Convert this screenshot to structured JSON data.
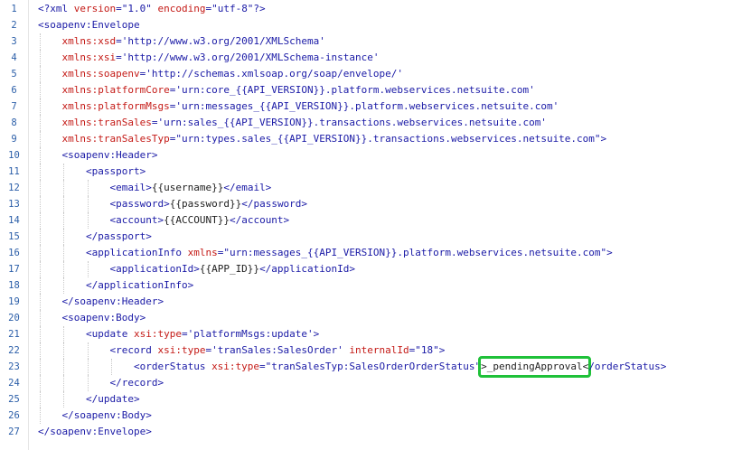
{
  "lines": [
    [
      {
        "t": "<?xml ",
        "c": "t-pi"
      },
      {
        "t": "version",
        "c": "t-attr"
      },
      {
        "t": "=\"1.0\" ",
        "c": "t-val"
      },
      {
        "t": "encoding",
        "c": "t-attr"
      },
      {
        "t": "=\"utf-8\"?>",
        "c": "t-val"
      }
    ],
    [
      {
        "t": "<soapenv:Envelope",
        "c": "t-tag"
      }
    ],
    [
      {
        "t": "    "
      },
      {
        "t": "xmlns:xsd",
        "c": "t-attr"
      },
      {
        "t": "='http://www.w3.org/2001/XMLSchema'",
        "c": "t-val"
      }
    ],
    [
      {
        "t": "    "
      },
      {
        "t": "xmlns:xsi",
        "c": "t-attr"
      },
      {
        "t": "='http://www.w3.org/2001/XMLSchema-instance'",
        "c": "t-val"
      }
    ],
    [
      {
        "t": "    "
      },
      {
        "t": "xmlns:soapenv",
        "c": "t-attr"
      },
      {
        "t": "='http://schemas.xmlsoap.org/soap/envelope/'",
        "c": "t-val"
      }
    ],
    [
      {
        "t": "    "
      },
      {
        "t": "xmlns:platformCore",
        "c": "t-attr"
      },
      {
        "t": "='urn:core_{{API_VERSION}}.platform.webservices.netsuite.com'",
        "c": "t-val"
      }
    ],
    [
      {
        "t": "    "
      },
      {
        "t": "xmlns:platformMsgs",
        "c": "t-attr"
      },
      {
        "t": "='urn:messages_{{API_VERSION}}.platform.webservices.netsuite.com'",
        "c": "t-val"
      }
    ],
    [
      {
        "t": "    "
      },
      {
        "t": "xmlns:tranSales",
        "c": "t-attr"
      },
      {
        "t": "='urn:sales_{{API_VERSION}}.transactions.webservices.netsuite.com'",
        "c": "t-val"
      }
    ],
    [
      {
        "t": "    "
      },
      {
        "t": "xmlns:tranSalesTyp",
        "c": "t-attr"
      },
      {
        "t": "=\"urn:types.sales_{{API_VERSION}}.transactions.webservices.netsuite.com\">",
        "c": "t-val"
      }
    ],
    [
      {
        "t": "    "
      },
      {
        "t": "<soapenv:Header>",
        "c": "t-tag"
      }
    ],
    [
      {
        "t": "        "
      },
      {
        "t": "<passport>",
        "c": "t-tag"
      }
    ],
    [
      {
        "t": "            "
      },
      {
        "t": "<email>",
        "c": "t-tag"
      },
      {
        "t": "{{username}}",
        "c": "t-txt"
      },
      {
        "t": "</email>",
        "c": "t-tag"
      }
    ],
    [
      {
        "t": "            "
      },
      {
        "t": "<password>",
        "c": "t-tag"
      },
      {
        "t": "{{password}}",
        "c": "t-txt"
      },
      {
        "t": "</password>",
        "c": "t-tag"
      }
    ],
    [
      {
        "t": "            "
      },
      {
        "t": "<account>",
        "c": "t-tag"
      },
      {
        "t": "{{ACCOUNT}}",
        "c": "t-txt"
      },
      {
        "t": "</account>",
        "c": "t-tag"
      }
    ],
    [
      {
        "t": "        "
      },
      {
        "t": "</passport>",
        "c": "t-tag"
      }
    ],
    [
      {
        "t": "        "
      },
      {
        "t": "<applicationInfo ",
        "c": "t-tag"
      },
      {
        "t": "xmlns",
        "c": "t-attr"
      },
      {
        "t": "=\"urn:messages_{{API_VERSION}}.platform.webservices.netsuite.com\">",
        "c": "t-val"
      }
    ],
    [
      {
        "t": "            "
      },
      {
        "t": "<applicationId>",
        "c": "t-tag"
      },
      {
        "t": "{{APP_ID}}",
        "c": "t-txt"
      },
      {
        "t": "</applicationId>",
        "c": "t-tag"
      }
    ],
    [
      {
        "t": "        "
      },
      {
        "t": "</applicationInfo>",
        "c": "t-tag"
      }
    ],
    [
      {
        "t": "    "
      },
      {
        "t": "</soapenv:Header>",
        "c": "t-tag"
      }
    ],
    [
      {
        "t": "    "
      },
      {
        "t": "<soapenv:Body>",
        "c": "t-tag"
      }
    ],
    [
      {
        "t": "        "
      },
      {
        "t": "<update ",
        "c": "t-tag"
      },
      {
        "t": "xsi:type",
        "c": "t-attr"
      },
      {
        "t": "='platformMsgs:update'>",
        "c": "t-val"
      }
    ],
    [
      {
        "t": "            "
      },
      {
        "t": "<record ",
        "c": "t-tag"
      },
      {
        "t": "xsi:type",
        "c": "t-attr"
      },
      {
        "t": "='tranSales:SalesOrder' ",
        "c": "t-val"
      },
      {
        "t": "internalId",
        "c": "t-attr"
      },
      {
        "t": "=\"18\">",
        "c": "t-val"
      }
    ],
    [
      {
        "t": "                "
      },
      {
        "t": "<orderStatus ",
        "c": "t-tag"
      },
      {
        "t": "xsi:type",
        "c": "t-attr"
      },
      {
        "t": "=\"tranSalesTyp:SalesOrderOrderStatus\"",
        "c": "t-val"
      },
      {
        "t": ">_pendingApproval<",
        "c": "t-txt",
        "hl": true
      },
      {
        "t": "/orderStatus>",
        "c": "t-tag"
      }
    ],
    [
      {
        "t": "            "
      },
      {
        "t": "</record>",
        "c": "t-tag"
      }
    ],
    [
      {
        "t": "        "
      },
      {
        "t": "</update>",
        "c": "t-tag"
      }
    ],
    [
      {
        "t": "    "
      },
      {
        "t": "</soapenv:Body>",
        "c": "t-tag"
      }
    ],
    [
      {
        "t": "</soapenv:Envelope>",
        "c": "t-tag",
        "caret": true
      }
    ]
  ],
  "line_numbers": [
    "1",
    "2",
    "3",
    "4",
    "5",
    "6",
    "7",
    "8",
    "9",
    "10",
    "11",
    "12",
    "13",
    "14",
    "15",
    "16",
    "17",
    "18",
    "19",
    "20",
    "21",
    "22",
    "23",
    "24",
    "25",
    "26",
    "27"
  ],
  "highlight_color": "#1fc139"
}
